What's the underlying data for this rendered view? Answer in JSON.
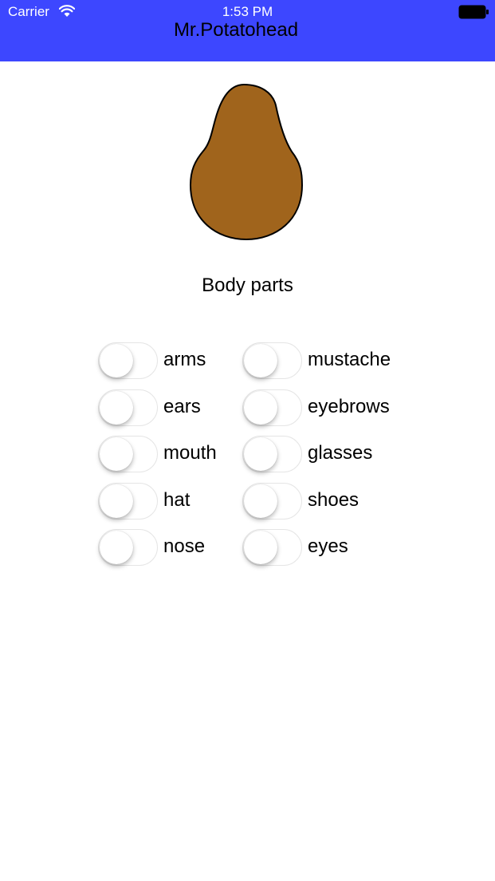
{
  "status_bar": {
    "carrier": "Carrier",
    "time": "1:53 PM"
  },
  "nav": {
    "title": "Mr.Potatohead"
  },
  "section": {
    "title": "Body parts"
  },
  "colors": {
    "nav_background": "#3d47ff",
    "potato_fill": "#a0641c"
  },
  "toggles": {
    "left": [
      {
        "label": "arms",
        "on": false
      },
      {
        "label": "ears",
        "on": false
      },
      {
        "label": "mouth",
        "on": false
      },
      {
        "label": "hat",
        "on": false
      },
      {
        "label": "nose",
        "on": false
      }
    ],
    "right": [
      {
        "label": "mustache",
        "on": false
      },
      {
        "label": "eyebrows",
        "on": false
      },
      {
        "label": "glasses",
        "on": false
      },
      {
        "label": "shoes",
        "on": false
      },
      {
        "label": "eyes",
        "on": false
      }
    ]
  }
}
